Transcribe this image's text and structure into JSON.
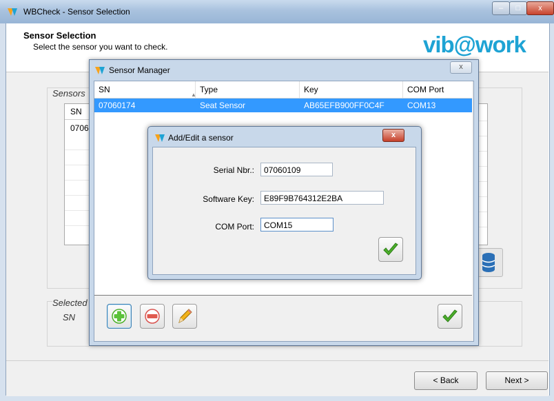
{
  "main_window": {
    "title": "WBCheck - Sensor Selection",
    "window_buttons": {
      "minimize": "–",
      "maximize": "□",
      "close": "x"
    }
  },
  "header": {
    "title": "Sensor Selection",
    "subtitle": "Select the sensor you want to check.",
    "logo": "vib@work"
  },
  "background_panel": {
    "sensors_group_label": "Sensors",
    "list_header": "SN",
    "list_row": "0706",
    "selected_group_label": "Selected",
    "sn_label": "SN"
  },
  "footer": {
    "back_label": "< Back",
    "next_label": "Next >"
  },
  "sensor_manager": {
    "title": "Sensor Manager",
    "close_label": "x",
    "columns": [
      "SN",
      "Type",
      "Key",
      "COM Port"
    ],
    "rows": [
      {
        "sn": "07060174",
        "type": "Seat Sensor",
        "key": "AB65EFB900FF0C4F",
        "com": "COM13"
      }
    ]
  },
  "add_edit_dialog": {
    "title": "Add/Edit a sensor",
    "close_label": "x",
    "serial_label": "Serial Nbr.:",
    "serial_value": "07060109",
    "key_label": "Software Key:",
    "key_value": "E89F9B764312E2BA",
    "com_label": "COM Port:",
    "com_value": "COM15"
  },
  "colors": {
    "accent": "#1ea3d4",
    "selection": "#3399ff",
    "ok_green": "#4caf2a",
    "remove_red": "#d9534f"
  }
}
